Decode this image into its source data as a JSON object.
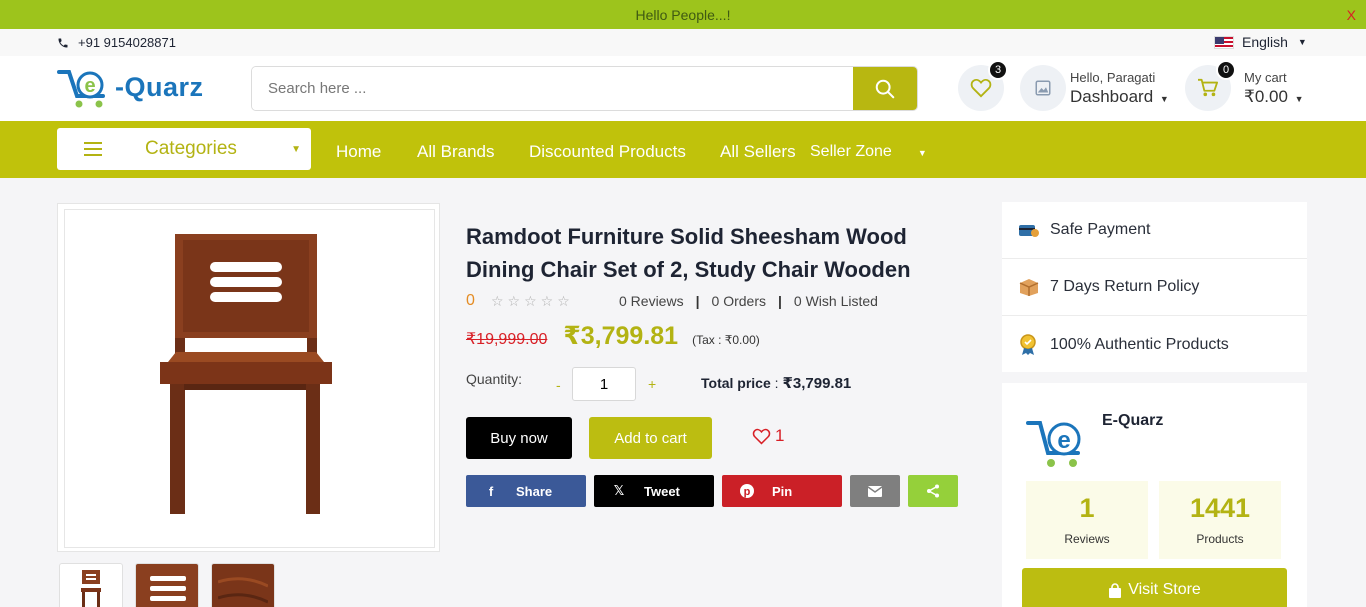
{
  "announcement": {
    "text": "Hello People...!",
    "close": "X"
  },
  "topbar": {
    "phone": "+91 9154028871",
    "language": "English"
  },
  "header": {
    "logo_text": "-Quarz",
    "search_placeholder": "Search here ...",
    "wishlist_count": "3",
    "dashboard_greeting": "Hello, Paragati",
    "dashboard_label": "Dashboard",
    "cart_count": "0",
    "cart_label": "My cart",
    "cart_total": "₹0.00"
  },
  "nav": {
    "categories_label": "Categories",
    "links": [
      "Home",
      "All Brands",
      "Discounted Products",
      "All Sellers",
      "Seller Zone"
    ]
  },
  "product": {
    "title": "Ramdoot Furniture Solid Sheesham Wood Dining Chair Set of 2, Study Chair Wooden",
    "rating": "0",
    "reviews": "0 Reviews",
    "orders": "0 Orders",
    "wish_listed": "0 Wish Listed",
    "old_price": "₹19,999.00",
    "price": "₹3,799.81",
    "tax": "(Tax : ₹0.00)",
    "quantity_label": "Quantity:",
    "quantity": "1",
    "qty_minus": "-",
    "qty_plus": "+",
    "total_label": "Total price",
    "total_price": "₹3,799.81",
    "buy_now": "Buy now",
    "add_to_cart": "Add to cart",
    "wish_count": "1"
  },
  "share": {
    "facebook": "Share",
    "twitter": "Tweet",
    "pinterest": "Pin"
  },
  "features": [
    "Safe Payment",
    "7 Days Return Policy",
    "100% Authentic Products"
  ],
  "seller": {
    "name": "E-Quarz",
    "reviews_count": "1",
    "reviews_label": "Reviews",
    "products_count": "1441",
    "products_label": "Products",
    "visit_store": "Visit Store"
  },
  "colors": {
    "primary": "#c0c20b",
    "announce": "#9dc41c",
    "price": "#b3b313",
    "danger": "#d81f26"
  }
}
